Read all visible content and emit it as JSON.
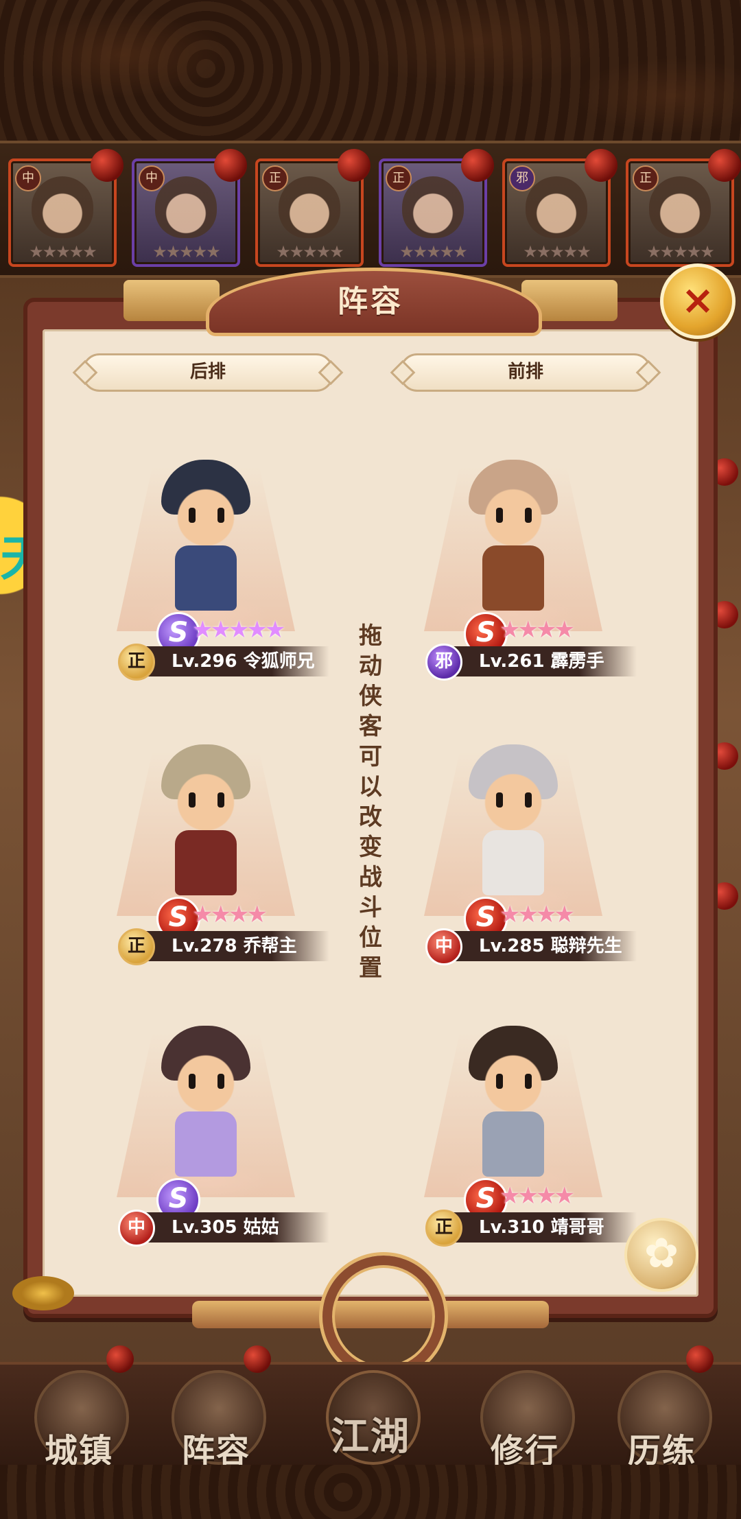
{
  "title": "阵容",
  "close_icon": "×",
  "labels": {
    "back_row": "后排",
    "front_row": "前排"
  },
  "hint": "拖动侠客可以改变战斗位置",
  "side_glyph": "天",
  "top_strip": [
    {
      "badge": "中",
      "stars": "★★★★★"
    },
    {
      "badge": "中",
      "stars": "★★★★★"
    },
    {
      "badge": "正",
      "stars": "★★★★★"
    },
    {
      "badge": "正",
      "stars": "★★★★★"
    },
    {
      "badge": "邪",
      "stars": "★★★★★"
    },
    {
      "badge": "正",
      "stars": "★★★★★"
    }
  ],
  "heroes": [
    {
      "name": "Lv.296 令狐师兄",
      "badge": "正",
      "stars": "★★★★★",
      "skill": "S"
    },
    {
      "name": "Lv.261 霹雳手",
      "badge": "邪",
      "stars": "★★★★",
      "skill": "S"
    },
    {
      "name": "Lv.278 乔帮主",
      "badge": "正",
      "stars": "★★★★",
      "skill": "S"
    },
    {
      "name": "Lv.285 聪辩先生",
      "badge": "中",
      "stars": "★★★★",
      "skill": "S"
    },
    {
      "name": "Lv.305 姑姑",
      "badge": "中",
      "stars": "",
      "skill": "S"
    },
    {
      "name": "Lv.310 靖哥哥",
      "badge": "正",
      "stars": "★★★★",
      "skill": "S"
    }
  ],
  "flower_icon": "✿",
  "nav": [
    {
      "label": "城镇"
    },
    {
      "label": "阵容"
    },
    {
      "label": "江湖"
    },
    {
      "label": "修行"
    },
    {
      "label": "历练"
    }
  ],
  "colors": {
    "panel_bg": "#f2e4d1",
    "frame": "#7b3a2c",
    "accent_gold": "#e3b46c",
    "name_bar": "#3a2520"
  }
}
